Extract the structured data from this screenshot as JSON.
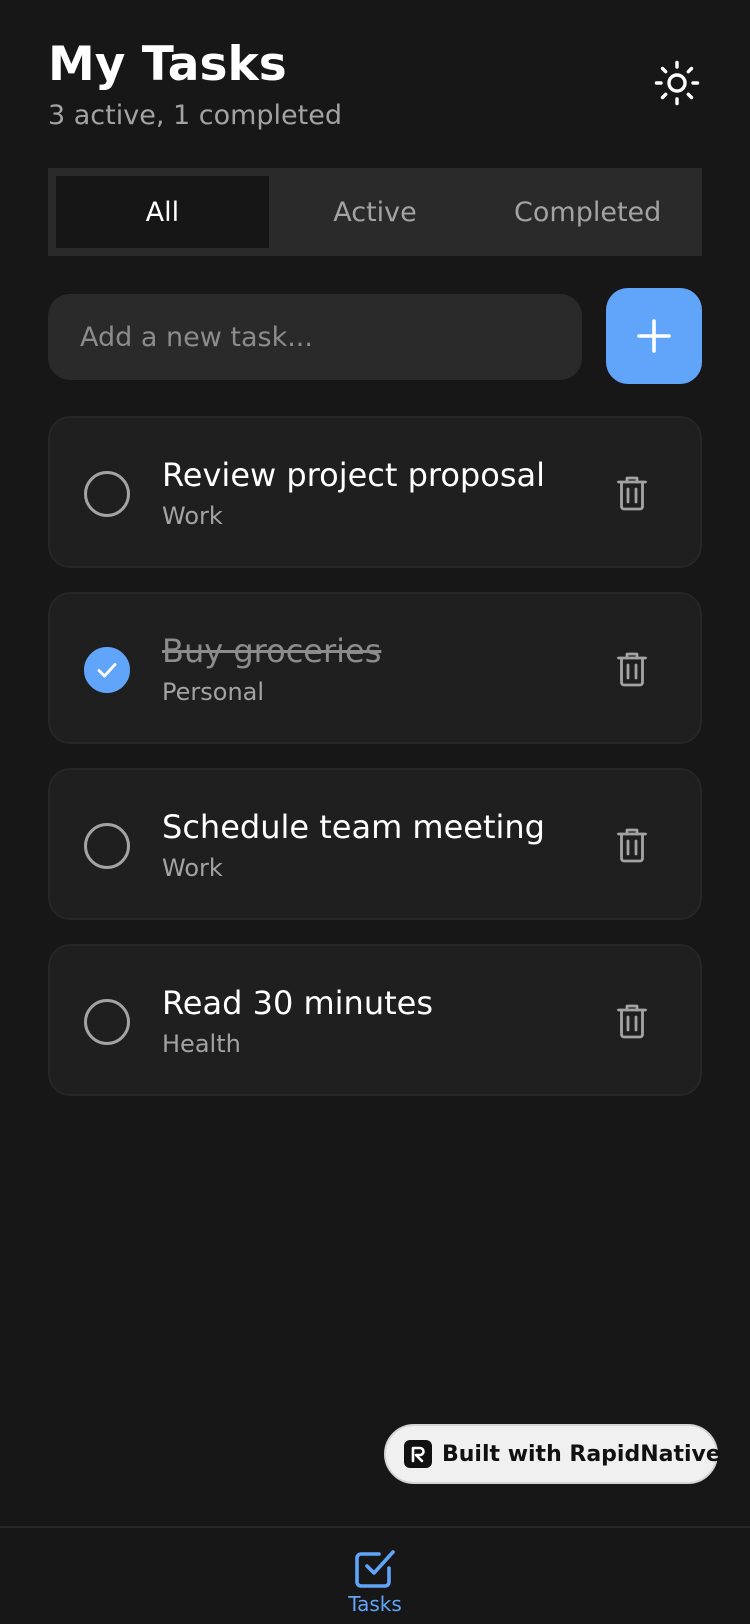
{
  "header": {
    "title": "My Tasks",
    "subtitle": "3 active, 1 completed",
    "theme_icon": "sun-icon"
  },
  "filters": {
    "selected": "All",
    "tabs": [
      {
        "label": "All"
      },
      {
        "label": "Active"
      },
      {
        "label": "Completed"
      }
    ]
  },
  "add_task": {
    "placeholder": "Add a new task...",
    "value": "",
    "button_icon": "plus-icon"
  },
  "tasks": [
    {
      "title": "Review project proposal",
      "category": "Work",
      "completed": false
    },
    {
      "title": "Buy groceries",
      "category": "Personal",
      "completed": true
    },
    {
      "title": "Schedule team meeting",
      "category": "Work",
      "completed": false
    },
    {
      "title": "Read 30 minutes",
      "category": "Health",
      "completed": false
    }
  ],
  "badge": {
    "label": "Built with RapidNative",
    "icon": "rapidnative-logo-icon"
  },
  "bottom_nav": {
    "items": [
      {
        "label": "Tasks",
        "icon": "checkbox-icon",
        "active": true
      }
    ]
  },
  "colors": {
    "background": "#171717",
    "surface": "#1f1f1f",
    "accent": "#60a5fa",
    "muted_text": "#a3a3a3"
  }
}
